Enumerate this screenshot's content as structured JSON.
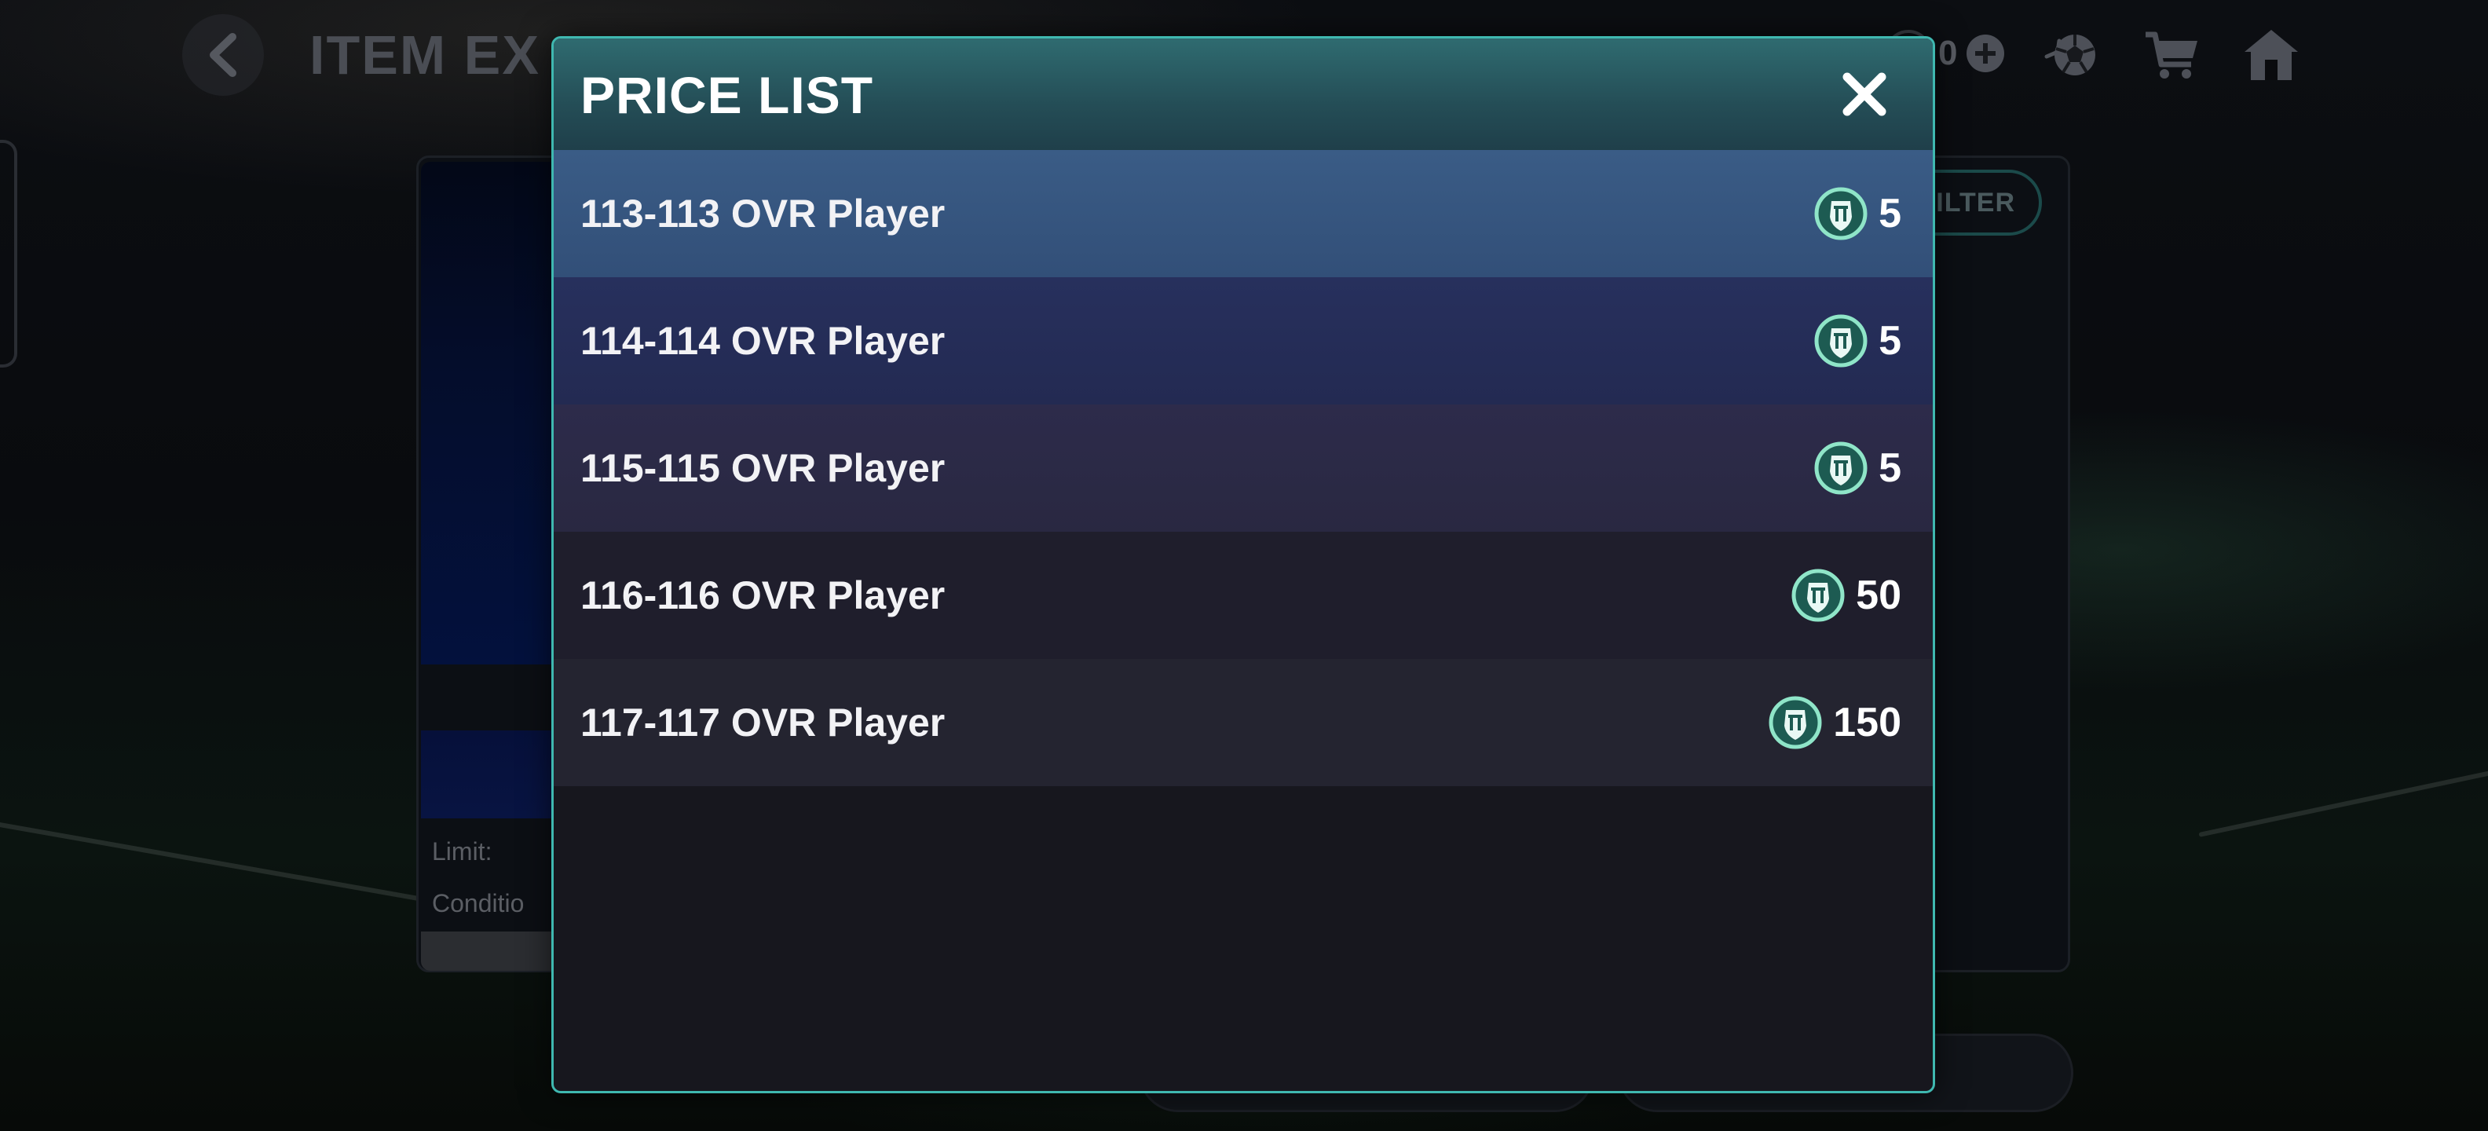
{
  "background": {
    "title": "ITEM EX",
    "currency_value": "0",
    "filter_label": "FILTER",
    "limit_label": "Limit:",
    "condition_label": "Conditio"
  },
  "modal": {
    "title": "PRICE LIST",
    "rows": [
      {
        "label": "113-113 OVR Player",
        "price": "5"
      },
      {
        "label": "114-114 OVR Player",
        "price": "5"
      },
      {
        "label": "115-115 OVR Player",
        "price": "5"
      },
      {
        "label": "116-116 OVR Player",
        "price": "50"
      },
      {
        "label": "117-117 OVR Player",
        "price": "150"
      }
    ]
  },
  "colors": {
    "modal_border": "#3fb8b0",
    "header_teal": "#2f6b70",
    "coin_ring": "#8fe5c8"
  },
  "icons": [
    "back-chevron-icon",
    "plus-icon",
    "football-icon",
    "cart-icon",
    "home-icon",
    "close-icon",
    "token-coin-icon"
  ]
}
